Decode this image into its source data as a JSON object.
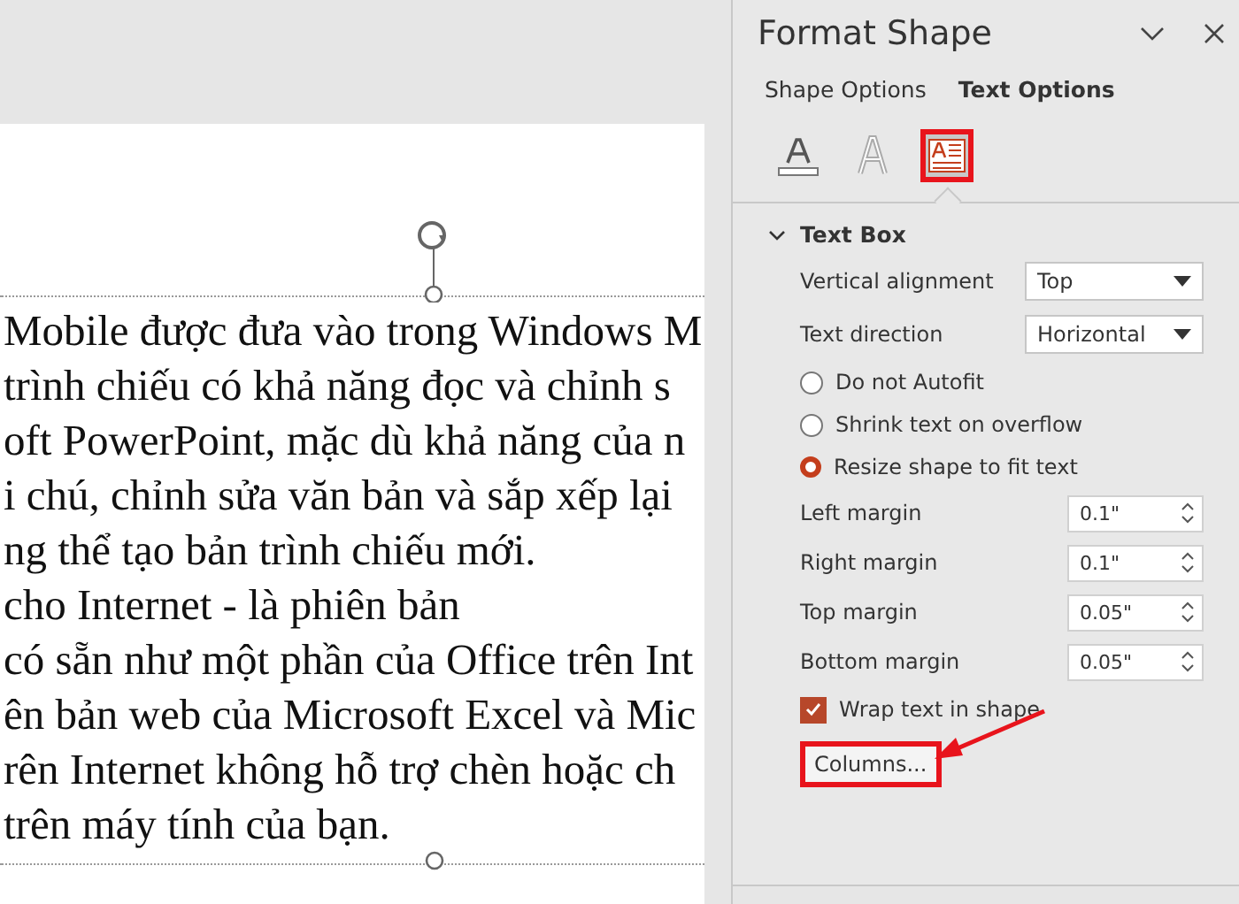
{
  "slide": {
    "lines": [
      "Mobile được đưa vào trong Windows M",
      "trình chiếu có khả năng đọc và chỉnh s",
      "oft PowerPoint, mặc dù khả năng của n",
      "i chú, chỉnh sửa văn bản và sắp xếp lại",
      "ng thể tạo bản trình chiếu mới.",
      "cho Internet - là phiên bản",
      "có sẵn như một phần của Office trên Int",
      "ên bản web của Microsoft Excel và Mic",
      "rên Internet không hỗ trợ chèn hoặc ch",
      "trên máy tính của bạn."
    ]
  },
  "pane": {
    "title": "Format Shape",
    "tabs": [
      {
        "label": "Shape Options",
        "selected": false
      },
      {
        "label": "Text Options",
        "selected": true
      }
    ],
    "icons": [
      {
        "kind": "fill",
        "selected": false,
        "highlighted": false
      },
      {
        "kind": "effects",
        "selected": false,
        "highlighted": false
      },
      {
        "kind": "textbox",
        "selected": true,
        "highlighted": true
      }
    ],
    "section": {
      "title": "Text Box",
      "expanded": true
    },
    "options": [
      {
        "kind": "dropdown",
        "label": "Vertical alignment",
        "value": "Top"
      },
      {
        "kind": "dropdown",
        "label": "Text direction",
        "value": "Horizontal"
      },
      {
        "kind": "radio",
        "label": "Do not Autofit",
        "selected": false
      },
      {
        "kind": "radio",
        "label": "Shrink text on overflow",
        "selected": false
      },
      {
        "kind": "radio",
        "label": "Resize shape to fit text",
        "selected": true
      },
      {
        "kind": "spinner",
        "label": "Left margin",
        "value": "0.1\""
      },
      {
        "kind": "spinner",
        "label": "Right margin",
        "value": "0.1\""
      },
      {
        "kind": "spinner",
        "label": "Top margin",
        "value": "0.05\""
      },
      {
        "kind": "spinner",
        "label": "Bottom margin",
        "value": "0.05\""
      },
      {
        "kind": "checkbox",
        "label": "Wrap text in shape",
        "checked": true
      },
      {
        "kind": "button",
        "label": "Columns...",
        "highlighted": true
      }
    ]
  }
}
